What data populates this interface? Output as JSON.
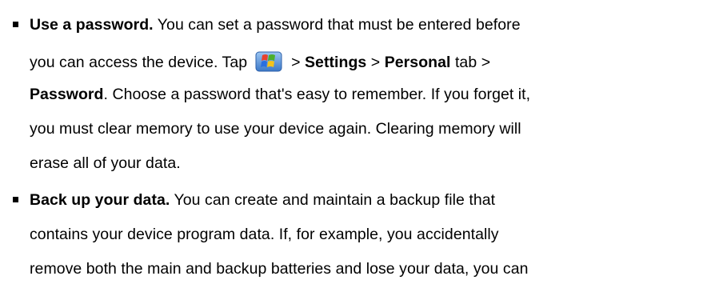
{
  "bullets": [
    {
      "title": "Use a password.",
      "line1": "You can set a password that must be entered before",
      "line2_a": "you can access the device. Tap",
      "start_icon": "windows-start-flag-icon",
      "line2_b": ">",
      "line2_settings": "Settings",
      "line2_c": ">",
      "line2_personal": "Personal",
      "line2_d": "tab >",
      "line3_password": "Password",
      "line3_rest": ". Choose a password that's easy to remember. If you forget it,",
      "line4": "you must clear memory to use your device again. Clearing memory will",
      "line5": "erase all of your data."
    },
    {
      "title": "Back up your data.",
      "line1": "You can create and maintain a backup file that",
      "line2": "contains your device program data. If, for example, you accidentally",
      "line3": "remove both the main and backup batteries and lose your data, you can"
    }
  ],
  "colors": {
    "text": "#000000",
    "background": "#ffffff"
  }
}
